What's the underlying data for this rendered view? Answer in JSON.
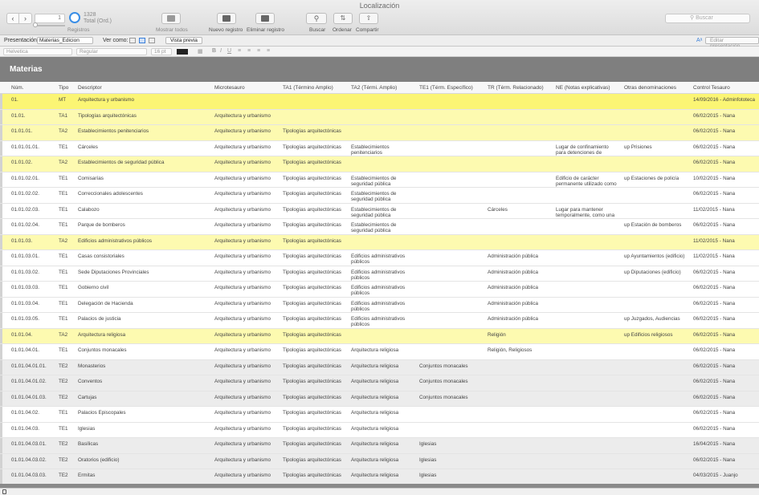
{
  "window": {
    "title": "Localización"
  },
  "toolbar": {
    "record_field": "1",
    "record_count": "1328",
    "record_total": "Total (Ord.)",
    "records_label": "Registros",
    "show_all": "Mostrar todos",
    "new_record": "Nuevo registro",
    "delete_record": "Eliminar registro",
    "find": "Buscar",
    "sort": "Ordenar",
    "share": "Compartir",
    "search_placeholder": "Buscar"
  },
  "layoutbar": {
    "presentation_label": "Presentación:",
    "presentation_value": "Materias_Edicion",
    "view_as_label": "Ver como:",
    "preview_button": "Vista previa",
    "aa_label": "Aᵃ",
    "edit_layout_button": "Editar presentación"
  },
  "formatbar": {
    "font": "Helvetica",
    "style": "Regular",
    "size": "16 pt"
  },
  "layout_title": "Materias",
  "columns": [
    "Núm.",
    "Tipo",
    "Descriptor",
    "Microtesauro",
    "TA1 (Término Amplio)",
    "TA2 (Térmi. Amplio)",
    "TE1 (Térm. Específico)",
    "TR (Térm. Relacionado)",
    "NE (Notas explicativas)",
    "Otras denominaciones",
    "Control Tesauro"
  ],
  "rows": [
    {
      "num": "01.",
      "tipo": "MT",
      "desc": "Arquitectura y urbanismo",
      "micro": "",
      "ta1": "",
      "ta2": "",
      "te1": "",
      "tr": "",
      "ne": "",
      "otras": "",
      "control": "14/09/2016 - Adminfototeca",
      "style": "first"
    },
    {
      "num": "01.01.",
      "tipo": "TA1",
      "desc": "Tipologías arquitectónicas",
      "micro": "Arquitectura y urbanismo",
      "ta1": "",
      "ta2": "",
      "te1": "",
      "tr": "",
      "ne": "",
      "otras": "",
      "control": "06/02/2015 - Nana",
      "style": "yellow"
    },
    {
      "num": "01.01.01.",
      "tipo": "TA2",
      "desc": "Establecimientos penitenciarios",
      "micro": "Arquitectura y urbanismo",
      "ta1": "Tipologías arquitectónicas",
      "ta2": "",
      "te1": "",
      "tr": "",
      "ne": "",
      "otras": "",
      "control": "06/02/2015 - Nana",
      "style": "yellow"
    },
    {
      "num": "01.01.01.01.",
      "tipo": "TE1",
      "desc": "Cárceles",
      "micro": "Arquitectura y urbanismo",
      "ta1": "Tipologías arquitectónicas",
      "ta2": "Establecimientos penitenciarios",
      "te1": "",
      "tr": "",
      "ne": "Lugar de confinamiento para detenciones de individuos y",
      "otras": "up Prisiones",
      "control": "06/02/2015 - Nana",
      "style": "white"
    },
    {
      "num": "01.01.02.",
      "tipo": "TA2",
      "desc": "Establecimientos de seguridad pública",
      "micro": "Arquitectura y urbanismo",
      "ta1": "Tipologías arquitectónicas",
      "ta2": "",
      "te1": "",
      "tr": "",
      "ne": "",
      "otras": "",
      "control": "06/02/2015 - Nana",
      "style": "yellow"
    },
    {
      "num": "01.01.02.01.",
      "tipo": "TE1",
      "desc": "Comisarías",
      "micro": "Arquitectura y urbanismo",
      "ta1": "Tipologías arquitectónicas",
      "ta2": "Establecimientos de seguridad pública",
      "te1": "",
      "tr": "",
      "ne": "Edificio de carácter permanente utilizado como",
      "otras": "up Estaciones de policía",
      "control": "10/02/2015 - Nana",
      "style": "white"
    },
    {
      "num": "01.01.02.02.",
      "tipo": "TE1",
      "desc": "Correccionales adolescentes",
      "micro": "Arquitectura y urbanismo",
      "ta1": "Tipologías arquitectónicas",
      "ta2": "Establecimientos de seguridad pública",
      "te1": "",
      "tr": "",
      "ne": "",
      "otras": "",
      "control": "06/02/2015 - Nana",
      "style": "white"
    },
    {
      "num": "01.01.02.03.",
      "tipo": "TE1",
      "desc": "Calabozo",
      "micro": "Arquitectura y urbanismo",
      "ta1": "Tipologías arquitectónicas",
      "ta2": "Establecimientos de seguridad pública",
      "te1": "",
      "tr": "Cárceles",
      "ne": "Lugar para mantener temporalmente, como una",
      "otras": "",
      "control": "11/02/2015 - Nana",
      "style": "white"
    },
    {
      "num": "01.01.02.04.",
      "tipo": "TE1",
      "desc": "Parque de bomberos",
      "micro": "Arquitectura y urbanismo",
      "ta1": "Tipologías arquitectónicas",
      "ta2": "Establecimientos de seguridad pública",
      "te1": "",
      "tr": "",
      "ne": "",
      "otras": "up Estación de bomberos",
      "control": "06/02/2015 - Nana",
      "style": "white"
    },
    {
      "num": "01.01.03.",
      "tipo": "TA2",
      "desc": "Edificios administrativos públicos",
      "micro": "Arquitectura y urbanismo",
      "ta1": "Tipologías arquitectónicas",
      "ta2": "",
      "te1": "",
      "tr": "",
      "ne": "",
      "otras": "",
      "control": "11/02/2015 - Nana",
      "style": "yellow"
    },
    {
      "num": "01.01.03.01.",
      "tipo": "TE1",
      "desc": "Casas consistoriales",
      "micro": "Arquitectura y urbanismo",
      "ta1": "Tipologías arquitectónicas",
      "ta2": "Edificios administrativos públicos",
      "te1": "",
      "tr": "Administración pública",
      "ne": "",
      "otras": "up Ayuntamientos (edificio)",
      "control": "11/02/2015 - Nana",
      "style": "white"
    },
    {
      "num": "01.01.03.02.",
      "tipo": "TE1",
      "desc": "Sede Diputaciones Provinciales",
      "micro": "Arquitectura y urbanismo",
      "ta1": "Tipologías arquitectónicas",
      "ta2": "Edificios administrativos públicos",
      "te1": "",
      "tr": "Administración pública",
      "ne": "",
      "otras": "up Diputaciones (edificio)",
      "control": "06/02/2015 - Nana",
      "style": "white"
    },
    {
      "num": "01.01.03.03.",
      "tipo": "TE1",
      "desc": "Gobierno civil",
      "micro": "Arquitectura y urbanismo",
      "ta1": "Tipologías arquitectónicas",
      "ta2": "Edificios administrativos públicos",
      "te1": "",
      "tr": "Administración pública",
      "ne": "",
      "otras": "",
      "control": "06/02/2015 - Nana",
      "style": "white"
    },
    {
      "num": "01.01.03.04.",
      "tipo": "TE1",
      "desc": "Delegación de Hacienda",
      "micro": "Arquitectura y urbanismo",
      "ta1": "Tipologías arquitectónicas",
      "ta2": "Edificios administrativos públicos",
      "te1": "",
      "tr": "Administración pública",
      "ne": "",
      "otras": "",
      "control": "06/02/2015 - Nana",
      "style": "white"
    },
    {
      "num": "01.01.03.05.",
      "tipo": "TE1",
      "desc": "Palacios de justicia",
      "micro": "Arquitectura y urbanismo",
      "ta1": "Tipologías arquitectónicas",
      "ta2": "Edificios administrativos públicos",
      "te1": "",
      "tr": "Administración pública",
      "ne": "",
      "otras": "up Juzgados, Audiencias",
      "control": "06/02/2015 - Nana",
      "style": "white"
    },
    {
      "num": "01.01.04.",
      "tipo": "TA2",
      "desc": "Arquitectura religiosa",
      "micro": "Arquitectura y urbanismo",
      "ta1": "Tipologías arquitectónicas",
      "ta2": "",
      "te1": "",
      "tr": "Religión",
      "ne": "",
      "otras": "up Edificios religiosos",
      "control": "06/02/2015 - Nana",
      "style": "yellow"
    },
    {
      "num": "01.01.04.01.",
      "tipo": "TE1",
      "desc": "Conjuntos monacales",
      "micro": "Arquitectura y urbanismo",
      "ta1": "Tipologías arquitectónicas",
      "ta2": "Arquitectura religiosa",
      "te1": "",
      "tr": "Religión, Religiosos",
      "ne": "",
      "otras": "",
      "control": "06/02/2015 - Nana",
      "style": "white"
    },
    {
      "num": "01.01.04.01.01.",
      "tipo": "TE2",
      "desc": "Monasterios",
      "micro": "Arquitectura y urbanismo",
      "ta1": "Tipologías arquitectónicas",
      "ta2": "Arquitectura religiosa",
      "te1": "Conjuntos monacales",
      "tr": "",
      "ne": "",
      "otras": "",
      "control": "06/02/2015 - Nana",
      "style": "grey"
    },
    {
      "num": "01.01.04.01.02.",
      "tipo": "TE2",
      "desc": "Conventos",
      "micro": "Arquitectura y urbanismo",
      "ta1": "Tipologías arquitectónicas",
      "ta2": "Arquitectura religiosa",
      "te1": "Conjuntos monacales",
      "tr": "",
      "ne": "",
      "otras": "",
      "control": "06/02/2015 - Nana",
      "style": "grey"
    },
    {
      "num": "01.01.04.01.03.",
      "tipo": "TE2",
      "desc": "Cartujas",
      "micro": "Arquitectura y urbanismo",
      "ta1": "Tipologías arquitectónicas",
      "ta2": "Arquitectura religiosa",
      "te1": "Conjuntos monacales",
      "tr": "",
      "ne": "",
      "otras": "",
      "control": "06/02/2015 - Nana",
      "style": "grey"
    },
    {
      "num": "01.01.04.02.",
      "tipo": "TE1",
      "desc": "Palacios Episcopales",
      "micro": "Arquitectura y urbanismo",
      "ta1": "Tipologías arquitectónicas",
      "ta2": "Arquitectura religiosa",
      "te1": "",
      "tr": "",
      "ne": "",
      "otras": "",
      "control": "06/02/2015 - Nana",
      "style": "white"
    },
    {
      "num": "01.01.04.03.",
      "tipo": "TE1",
      "desc": "Iglesias",
      "micro": "Arquitectura y urbanismo",
      "ta1": "Tipologías arquitectónicas",
      "ta2": "Arquitectura religiosa",
      "te1": "",
      "tr": "",
      "ne": "",
      "otras": "",
      "control": "06/02/2015 - Nana",
      "style": "white"
    },
    {
      "num": "01.01.04.03.01.",
      "tipo": "TE2",
      "desc": "Basílicas",
      "micro": "Arquitectura y urbanismo",
      "ta1": "Tipologías arquitectónicas",
      "ta2": "Arquitectura religiosa",
      "te1": "Iglesias",
      "tr": "",
      "ne": "",
      "otras": "",
      "control": "16/04/2015 - Nana",
      "style": "grey"
    },
    {
      "num": "01.01.04.03.02.",
      "tipo": "TE2",
      "desc": "Oratorios (edificio)",
      "micro": "Arquitectura y urbanismo",
      "ta1": "Tipologías arquitectónicas",
      "ta2": "Arquitectura religiosa",
      "te1": "Iglesias",
      "tr": "",
      "ne": "",
      "otras": "",
      "control": "06/02/2015 - Nana",
      "style": "grey"
    },
    {
      "num": "01.01.04.03.03.",
      "tipo": "TE2",
      "desc": "Ermitas",
      "micro": "Arquitectura y urbanismo",
      "ta1": "Tipologías arquitectónicas",
      "ta2": "Arquitectura religiosa",
      "te1": "Iglesias",
      "tr": "",
      "ne": "",
      "otras": "",
      "control": "04/03/2015 - Juanjo",
      "style": "grey"
    }
  ]
}
